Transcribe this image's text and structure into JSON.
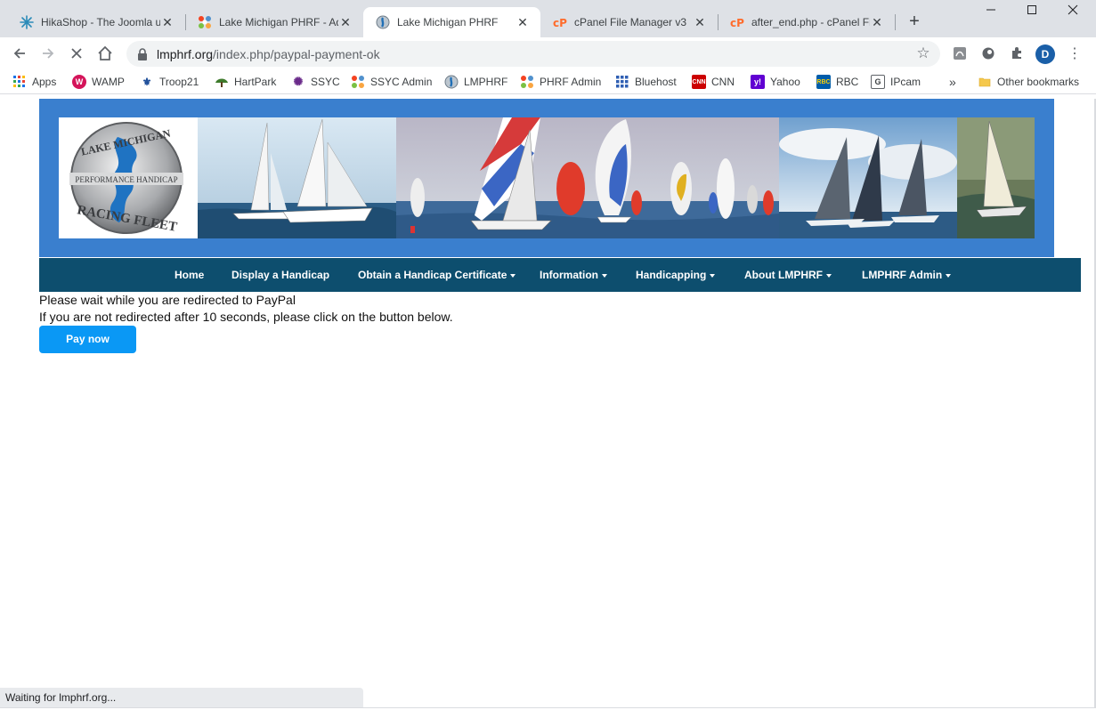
{
  "browser": {
    "tabs": [
      {
        "title": "HikaShop - The Joomla u",
        "favicon": "hikashop-icon"
      },
      {
        "title": "Lake Michigan PHRF - Ad",
        "favicon": "joomla-icon"
      },
      {
        "title": "Lake Michigan PHRF",
        "favicon": "lmphrf-icon"
      },
      {
        "title": "cPanel File Manager v3",
        "favicon": "cpanel-icon"
      },
      {
        "title": "after_end.php - cPanel Fil",
        "favicon": "cpanel-icon"
      }
    ],
    "new_tab": "+",
    "url_host": "lmphrf.org",
    "url_path": "/index.php/paypal-payment-ok",
    "profile_initial": "D",
    "bookmarks": [
      {
        "label": "Apps"
      },
      {
        "label": "WAMP"
      },
      {
        "label": "Troop21"
      },
      {
        "label": "HartPark"
      },
      {
        "label": "SSYC"
      },
      {
        "label": "SSYC Admin"
      },
      {
        "label": "LMPHRF"
      },
      {
        "label": "PHRF Admin"
      },
      {
        "label": "Bluehost"
      },
      {
        "label": "CNN"
      },
      {
        "label": "Yahoo"
      },
      {
        "label": "RBC"
      },
      {
        "label": "IPcam"
      }
    ],
    "bookmarks_overflow": "»",
    "other_bookmarks": "Other bookmarks",
    "status_text": "Waiting for lmphrf.org..."
  },
  "site": {
    "logo_text_top": "LAKE MICHIGAN",
    "logo_text_middle": "PERFORMANCE HANDICAP",
    "logo_text_bottom": "RACING FLEET",
    "nav": [
      {
        "label": "Home",
        "dropdown": false
      },
      {
        "label": "Display a Handicap",
        "dropdown": false
      },
      {
        "label": "Obtain a Handicap Certificate",
        "dropdown": true
      },
      {
        "label": "Information",
        "dropdown": true
      },
      {
        "label": "Handicapping",
        "dropdown": true
      },
      {
        "label": "About LMPHRF",
        "dropdown": true
      },
      {
        "label": "LMPHRF Admin",
        "dropdown": true
      }
    ]
  },
  "content": {
    "line1": "Please wait while you are redirected to PayPal",
    "line2": "If you are not redirected after 10 seconds, please click on the button below.",
    "pay_button": "Pay now"
  },
  "colors": {
    "header_band": "#3a7fce",
    "nav_bar": "#0d4e6e",
    "pay_button": "#0a98f5"
  }
}
